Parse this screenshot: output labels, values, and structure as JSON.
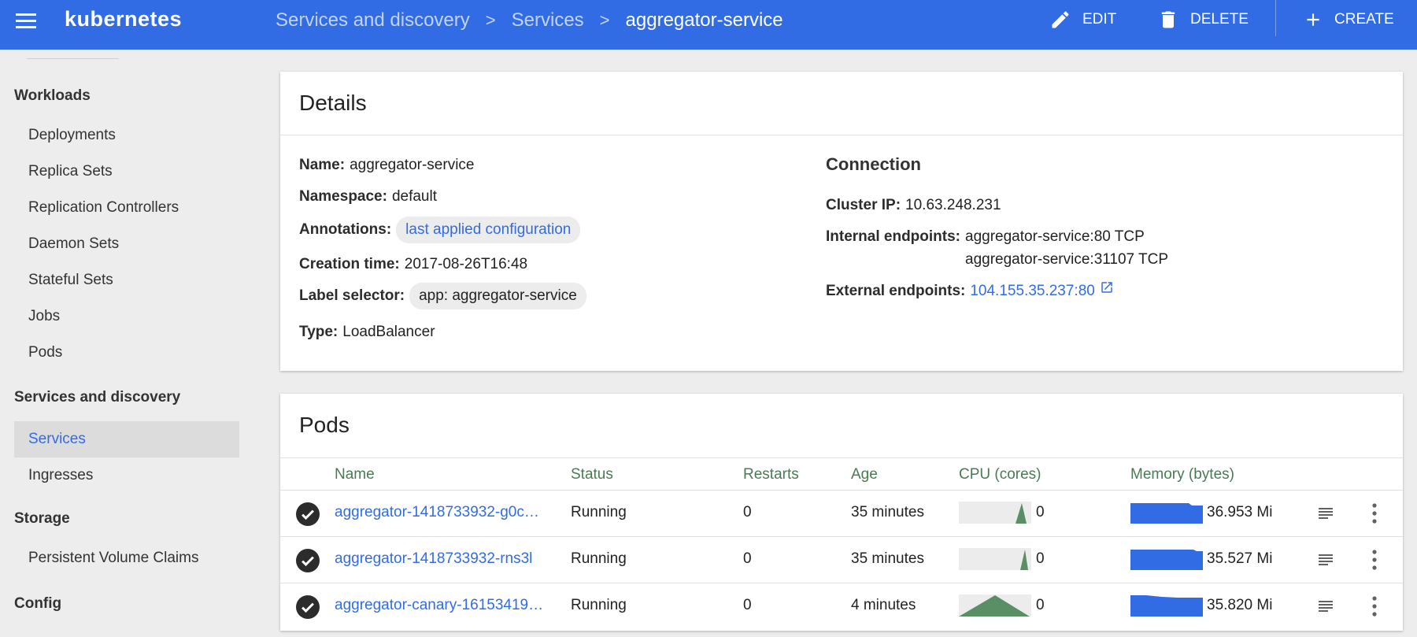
{
  "topbar": {
    "logo": "kubernetes",
    "breadcrumb": [
      "Services and discovery",
      "Services"
    ],
    "breadcrumb_current": "aggregator-service",
    "edit_label": "EDIT",
    "delete_label": "DELETE",
    "create_label": "CREATE",
    "color": "#326ce5"
  },
  "sidebar": {
    "sections": [
      {
        "title": "Workloads",
        "items": [
          "Deployments",
          "Replica Sets",
          "Replication Controllers",
          "Daemon Sets",
          "Stateful Sets",
          "Jobs",
          "Pods"
        ]
      },
      {
        "title": "Services and discovery",
        "items": [
          "Services",
          "Ingresses"
        ]
      },
      {
        "title": "Storage",
        "items": [
          "Persistent Volume Claims"
        ]
      },
      {
        "title": "Config",
        "items": []
      }
    ],
    "active_item": "Services"
  },
  "details": {
    "title": "Details",
    "name_key": "Name:",
    "name": "aggregator-service",
    "namespace_key": "Namespace:",
    "namespace": "default",
    "annotations_key": "Annotations:",
    "annotations": "last applied configuration",
    "creation_key": "Creation time:",
    "creation": "2017-08-26T16:48",
    "selector_key": "Label selector:",
    "selector": "app: aggregator-service",
    "type_key": "Type:",
    "type": "LoadBalancer",
    "connection": {
      "title": "Connection",
      "cluster_ip_key": "Cluster IP:",
      "cluster_ip": "10.63.248.231",
      "internal_key": "Internal endpoints:",
      "internal": [
        "aggregator-service:80 TCP",
        "aggregator-service:31107 TCP"
      ],
      "external_key": "External endpoints:",
      "external": "104.155.35.237:80"
    }
  },
  "pods": {
    "title": "Pods",
    "columns": [
      "Name",
      "Status",
      "Restarts",
      "Age",
      "CPU (cores)",
      "Memory (bytes)"
    ],
    "rows": [
      {
        "name": "aggregator-1418733932-g0c…",
        "status": "Running",
        "restarts": "0",
        "age": "35 minutes",
        "cpu": "0",
        "memory": "36.953 Mi"
      },
      {
        "name": "aggregator-1418733932-rns3l",
        "status": "Running",
        "restarts": "0",
        "age": "35 minutes",
        "cpu": "0",
        "memory": "35.527 Mi"
      },
      {
        "name": "aggregator-canary-16153419…",
        "status": "Running",
        "restarts": "0",
        "age": "4 minutes",
        "cpu": "0",
        "memory": "35.820 Mi"
      }
    ],
    "cpu_color": "#5a8f66",
    "memory_color": "#326ce5"
  }
}
